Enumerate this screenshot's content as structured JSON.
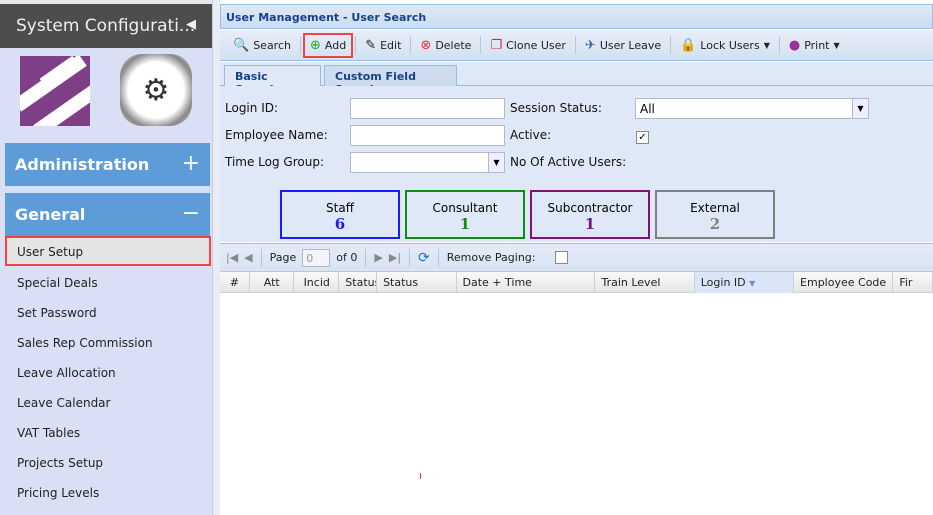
{
  "sidebar": {
    "title": "System Configurati...",
    "collapse_icon": "triangle-left-icon",
    "sections": [
      {
        "label": "Administration",
        "toggle": "+"
      },
      {
        "label": "General",
        "toggle": "−"
      }
    ],
    "items": [
      "User Setup",
      "Special Deals",
      "Set Password",
      "Sales Rep Commission",
      "Leave Allocation",
      "Leave Calendar",
      "VAT Tables",
      "Projects Setup",
      "Pricing Levels"
    ],
    "selected": "User Setup"
  },
  "panel": {
    "title": "User Management - User Search"
  },
  "toolbar": {
    "search": "Search",
    "add": "Add",
    "edit": "Edit",
    "delete": "Delete",
    "clone": "Clone User",
    "leave": "User Leave",
    "lock": "Lock Users",
    "print": "Print"
  },
  "tabs": [
    "Basic Search",
    "Custom Field Search"
  ],
  "form": {
    "login_id_label": "Login ID:",
    "login_id_value": "",
    "employee_name_label": "Employee Name:",
    "employee_name_value": "",
    "time_log_group_label": "Time Log Group:",
    "time_log_group_value": "",
    "session_status_label": "Session Status:",
    "session_status_value": "All",
    "active_label": "Active:",
    "active_checked": true,
    "active_users_label": "No Of Active Users:"
  },
  "cards": [
    {
      "label": "Staff",
      "count": "6",
      "color": "#1a1aff"
    },
    {
      "label": "Consultant",
      "count": "1",
      "color": "#138a13"
    },
    {
      "label": "Subcontractor",
      "count": "1",
      "color": "#7a147a"
    },
    {
      "label": "External",
      "count": "2",
      "color": "#808080"
    }
  ],
  "paging": {
    "page_label": "Page",
    "page_value": "0",
    "of_label": "of 0",
    "remove_paging_label": "Remove Paging:",
    "remove_paging_checked": false
  },
  "columns": [
    "#",
    "Att",
    "Incid",
    "Status",
    "Status",
    "Date + Time",
    "Train Level",
    "Login ID",
    "Employee Code",
    "Fir"
  ],
  "sorted_column": "Login ID"
}
